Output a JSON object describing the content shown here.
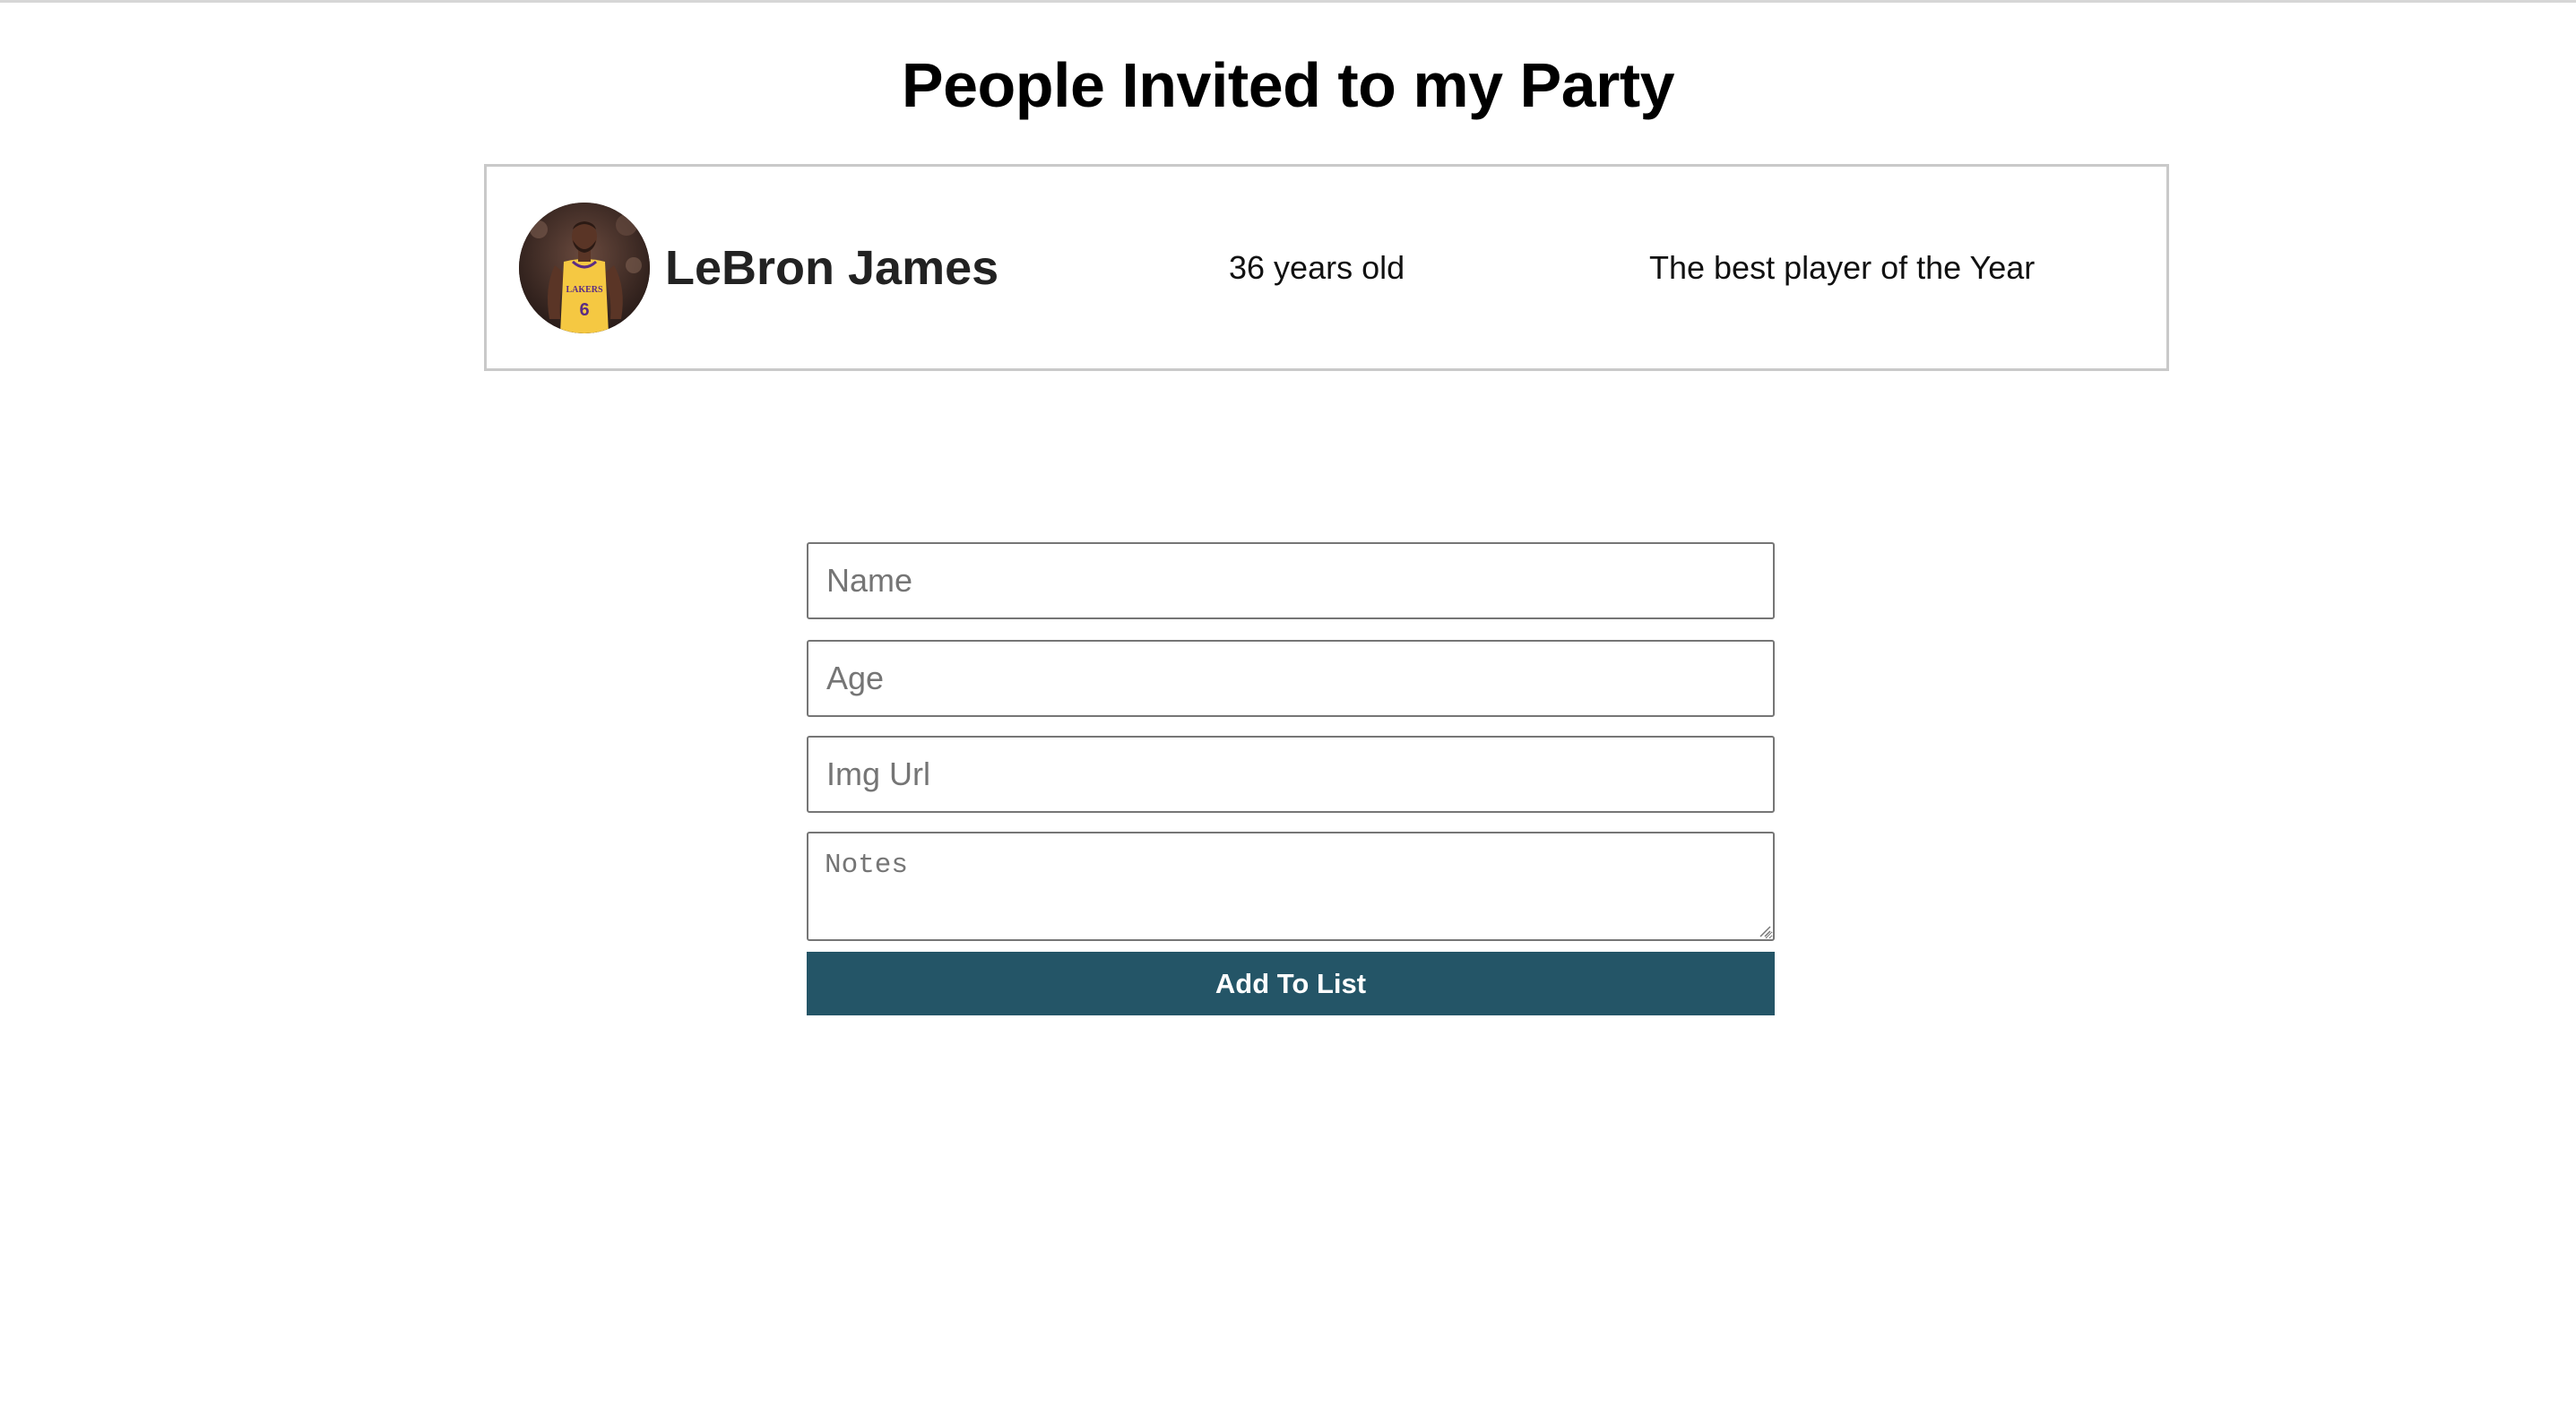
{
  "page": {
    "title": "People Invited to my Party"
  },
  "guests": [
    {
      "name": "LeBron James",
      "age_text": "36 years old",
      "note": "The best player of the Year",
      "avatar_icon": "person-photo"
    }
  ],
  "form": {
    "name_placeholder": "Name",
    "age_placeholder": "Age",
    "img_url_placeholder": "Img Url",
    "notes_placeholder": "Notes",
    "submit_label": "Add To List"
  },
  "colors": {
    "button_bg": "#245567",
    "button_text": "#ffffff",
    "card_border": "#c9c9c9",
    "jersey": "#f5c842"
  }
}
